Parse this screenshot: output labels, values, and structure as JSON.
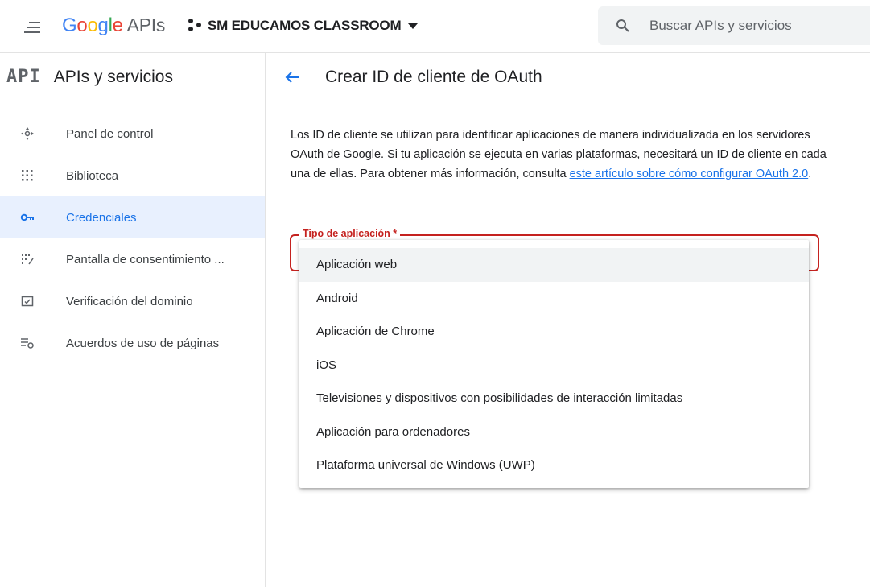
{
  "topbar": {
    "logo": {
      "letters": [
        "G",
        "o",
        "o",
        "g",
        "l",
        "e"
      ],
      "suffix": "APIs"
    },
    "project": "SM EDUCAMOS CLASSROOM",
    "search": {
      "placeholder": "Buscar APIs y servicios"
    }
  },
  "sidebar": {
    "badge": "API",
    "title": "APIs y servicios",
    "items": [
      {
        "label": "Panel de control",
        "icon": "dashboard-icon",
        "active": false
      },
      {
        "label": "Biblioteca",
        "icon": "library-icon",
        "active": false
      },
      {
        "label": "Credenciales",
        "icon": "key-icon",
        "active": true
      },
      {
        "label": "Pantalla de consentimiento ...",
        "icon": "consent-icon",
        "active": false
      },
      {
        "label": "Verificación del dominio",
        "icon": "domain-check-icon",
        "active": false
      },
      {
        "label": "Acuerdos de uso de páginas",
        "icon": "settings-list-icon",
        "active": false
      }
    ]
  },
  "main": {
    "title": "Crear ID de cliente de OAuth",
    "description": "Los ID de cliente se utilizan para identificar aplicaciones de manera individualizada en los servidores OAuth de Google. Si tu aplicación se ejecuta en varias plataformas, necesitará un ID de cliente en cada una de ellas. Para obtener más información, consulta",
    "link": "este artículo sobre cómo configurar OAuth 2.0",
    "link_suffix": ".",
    "field_label": "Tipo de aplicación *",
    "options": [
      "Aplicación web",
      "Android",
      "Aplicación de Chrome",
      "iOS",
      "Televisiones y dispositivos con posibilidades de interacción limitadas",
      "Aplicación para ordenadores",
      "Plataforma universal de Windows (UWP)"
    ],
    "highlighted_option": "Aplicación web"
  },
  "colors": {
    "accent": "#1a73e8",
    "active_bg": "#e8f0fe",
    "error": "#c5221f"
  }
}
